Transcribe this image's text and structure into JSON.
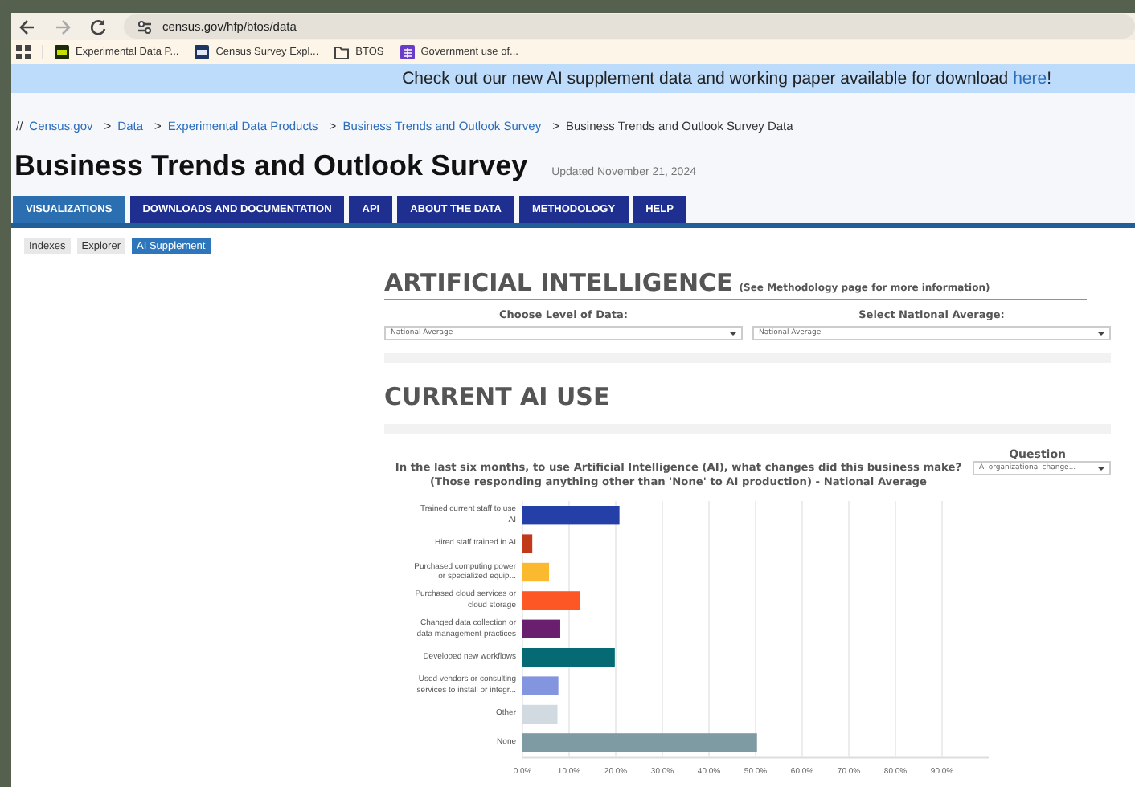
{
  "browser": {
    "url": "census.gov/hfp/btos/data",
    "bookmarks": [
      {
        "label": "Experimental Data P...",
        "kind": "census-green"
      },
      {
        "label": "Census Survey Expl...",
        "kind": "census-navy"
      },
      {
        "label": "BTOS",
        "kind": "folder"
      },
      {
        "label": "Government use of...",
        "kind": "grid-purple"
      }
    ]
  },
  "banner": {
    "text": "Check out our new AI supplement data and working paper available for download ",
    "link": "here",
    "after": "!"
  },
  "breadcrumb_prefix": "//",
  "breadcrumbs": [
    {
      "label": "Census.gov",
      "link": true
    },
    {
      "sep": ">",
      "label": "Data",
      "link": true
    },
    {
      "sep": ">",
      "label": "Experimental Data Products",
      "link": true
    },
    {
      "sep": ">",
      "label": "Business Trends and Outlook Survey",
      "link": true
    },
    {
      "sep": ">",
      "label": "Business Trends and Outlook Survey Data",
      "link": false
    }
  ],
  "title": "Business Trends and Outlook Survey",
  "updated": "Updated November 21, 2024",
  "nav_tabs": [
    {
      "label": "VISUALIZATIONS",
      "selected": true
    },
    {
      "label": "DOWNLOADS AND DOCUMENTATION",
      "selected": false
    },
    {
      "label": "API",
      "selected": false
    },
    {
      "label": "ABOUT THE DATA",
      "selected": false
    },
    {
      "label": "METHODOLOGY",
      "selected": false
    },
    {
      "label": "HELP",
      "selected": false
    }
  ],
  "sub_tabs": [
    {
      "label": "Indexes",
      "selected": false
    },
    {
      "label": "Explorer",
      "selected": false
    },
    {
      "label": "AI Supplement",
      "selected": true
    }
  ],
  "section": {
    "title": "ARTIFICIAL INTELLIGENCE",
    "note": "(See Methodology page for more information)"
  },
  "filters": [
    {
      "label": "Choose Level of Data:",
      "value": "National Average"
    },
    {
      "label": "Select National Average:",
      "value": "National Average"
    }
  ],
  "section2": {
    "title": "CURRENT AI USE"
  },
  "question_filter": {
    "label": "Question",
    "value": "AI organizational change..."
  },
  "chart_title": [
    "In the last six months, to use Artificial Intelligence (AI), what changes did this business make?",
    "(Those responding anything other than 'None' to AI production) - National Average"
  ],
  "chart_data": {
    "type": "bar",
    "orientation": "horizontal",
    "categories": [
      "Trained current staff to use AI",
      "Hired staff trained in AI",
      "Purchased computing power or specialized equip...",
      "Purchased cloud services or cloud storage",
      "Changed data collection or data management practices",
      "Developed new workflows",
      "Used vendors or consulting services to install or integr...",
      "Other",
      "None"
    ],
    "values": [
      20.8,
      2.1,
      5.7,
      12.4,
      8.1,
      19.8,
      7.7,
      7.5,
      50.3
    ],
    "grid": true,
    "colors": [
      "#2440a8",
      "#c0391b",
      "#fbb92f",
      "#fe5726",
      "#6a1f6e",
      "#056a73",
      "#8495e0",
      "#d0dae0",
      "#7e9aa3"
    ],
    "xlim": [
      0,
      100
    ],
    "xticks": [
      {
        "value": 0,
        "label": "0.0%"
      },
      {
        "value": 10,
        "label": "10.0%"
      },
      {
        "value": 20,
        "label": "20.0%"
      },
      {
        "value": 30,
        "label": "30.0%"
      },
      {
        "value": 40,
        "label": "40.0%"
      },
      {
        "value": 50,
        "label": "50.0%"
      },
      {
        "value": 60,
        "label": "60.0%"
      },
      {
        "value": 70,
        "label": "70.0%"
      },
      {
        "value": 80,
        "label": "80.0%"
      },
      {
        "value": 90,
        "label": "90.0%"
      }
    ]
  }
}
